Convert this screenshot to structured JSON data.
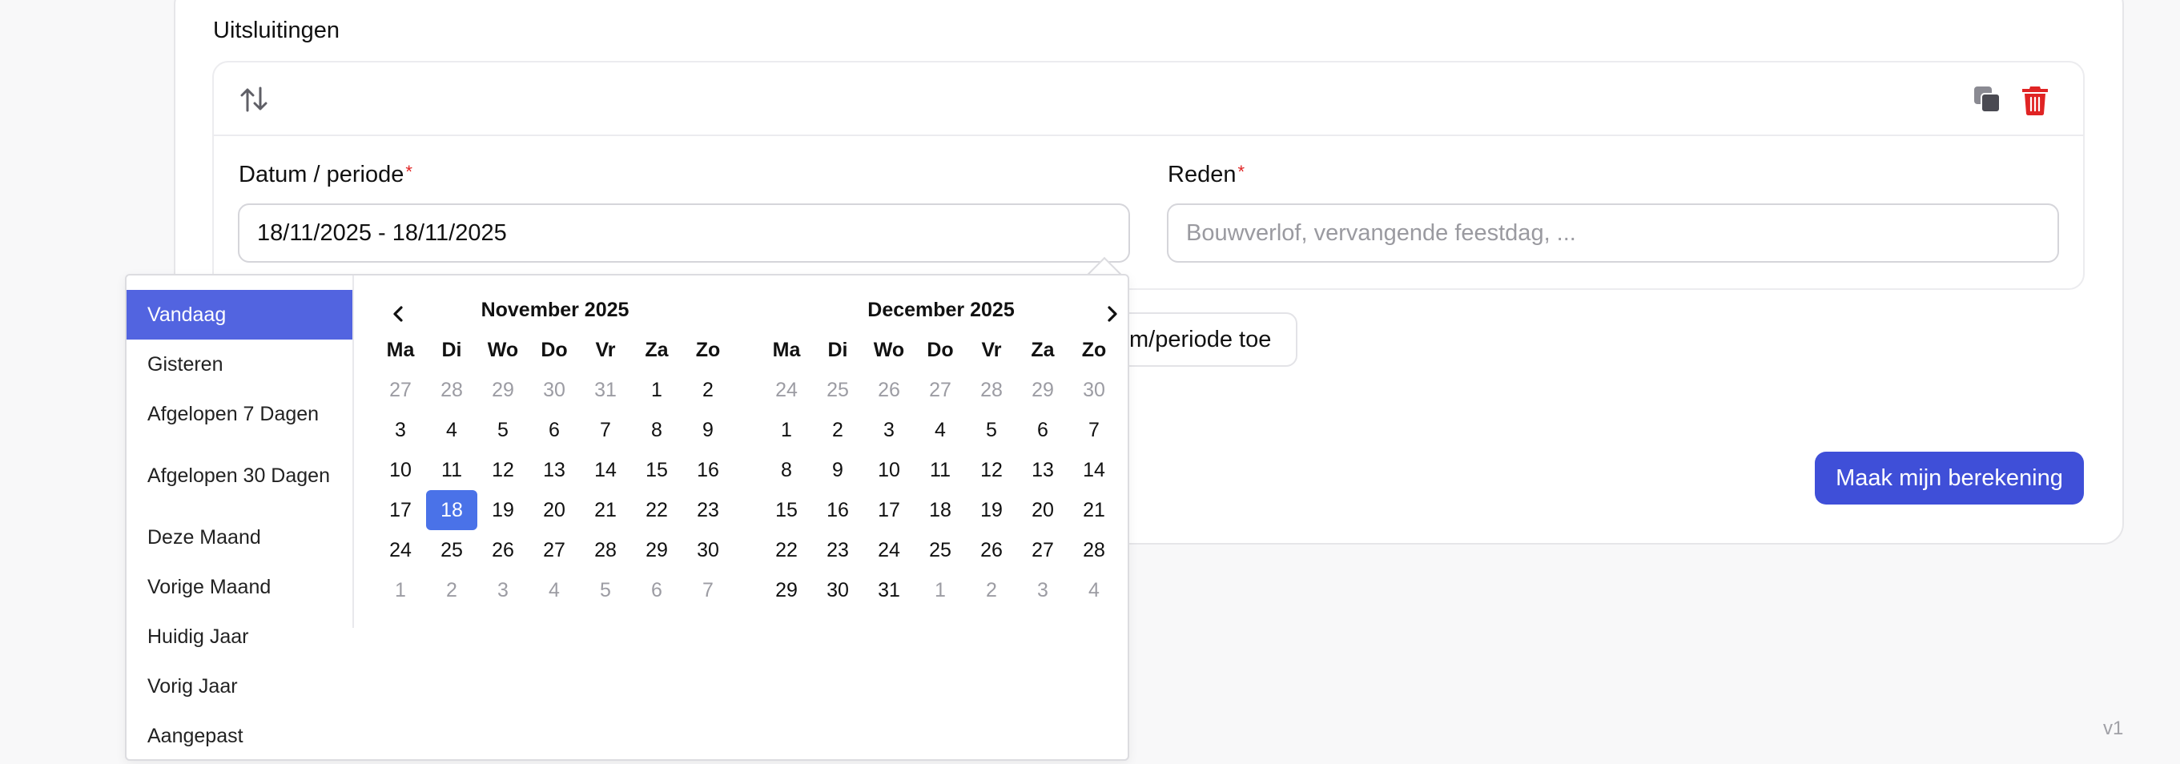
{
  "section": {
    "title": "Uitsluitingen"
  },
  "form": {
    "date_label": "Datum / periode",
    "date_required": "*",
    "date_value": "18/11/2025 - 18/11/2025",
    "reason_label": "Reden",
    "reason_required": "*",
    "reason_placeholder": "Bouwverlof, vervangende feestdag, ..."
  },
  "add_button": {
    "label": "m/periode toe"
  },
  "calc_button": {
    "label": "Maak mijn berekening"
  },
  "version": "v1",
  "icons": {
    "sort": "sort-arrows-icon",
    "copy": "copy-icon",
    "trash": "trash-icon",
    "prev": "chevron-left-icon",
    "next": "chevron-right-icon"
  },
  "colors": {
    "accent": "#3f4fd8",
    "active_range": "#5264e0",
    "selected_day": "#4a72e8",
    "danger": "#e02424"
  },
  "picker": {
    "ranges": [
      {
        "label": "Vandaag",
        "active": true
      },
      {
        "label": "Gisteren"
      },
      {
        "label": "Afgelopen 7 Dagen"
      },
      {
        "label": "Afgelopen 30 Dagen"
      },
      {
        "label": "Deze Maand"
      },
      {
        "label": "Vorige Maand"
      },
      {
        "label": "Huidig Jaar"
      },
      {
        "label": "Vorig Jaar"
      },
      {
        "label": "Aangepast"
      }
    ],
    "weekdays": [
      "Ma",
      "Di",
      "Wo",
      "Do",
      "Vr",
      "Za",
      "Zo"
    ],
    "months": [
      {
        "title": "November 2025",
        "days": [
          {
            "d": "27",
            "off": true
          },
          {
            "d": "28",
            "off": true
          },
          {
            "d": "29",
            "off": true
          },
          {
            "d": "30",
            "off": true
          },
          {
            "d": "31",
            "off": true
          },
          {
            "d": "1"
          },
          {
            "d": "2"
          },
          {
            "d": "3"
          },
          {
            "d": "4"
          },
          {
            "d": "5"
          },
          {
            "d": "6"
          },
          {
            "d": "7"
          },
          {
            "d": "8"
          },
          {
            "d": "9"
          },
          {
            "d": "10"
          },
          {
            "d": "11"
          },
          {
            "d": "12"
          },
          {
            "d": "13"
          },
          {
            "d": "14"
          },
          {
            "d": "15"
          },
          {
            "d": "16"
          },
          {
            "d": "17"
          },
          {
            "d": "18",
            "sel": true
          },
          {
            "d": "19"
          },
          {
            "d": "20"
          },
          {
            "d": "21"
          },
          {
            "d": "22"
          },
          {
            "d": "23"
          },
          {
            "d": "24"
          },
          {
            "d": "25"
          },
          {
            "d": "26"
          },
          {
            "d": "27"
          },
          {
            "d": "28"
          },
          {
            "d": "29"
          },
          {
            "d": "30"
          },
          {
            "d": "1",
            "off": true
          },
          {
            "d": "2",
            "off": true
          },
          {
            "d": "3",
            "off": true
          },
          {
            "d": "4",
            "off": true
          },
          {
            "d": "5",
            "off": true
          },
          {
            "d": "6",
            "off": true
          },
          {
            "d": "7",
            "off": true
          }
        ]
      },
      {
        "title": "December 2025",
        "days": [
          {
            "d": "24",
            "off": true
          },
          {
            "d": "25",
            "off": true
          },
          {
            "d": "26",
            "off": true
          },
          {
            "d": "27",
            "off": true
          },
          {
            "d": "28",
            "off": true
          },
          {
            "d": "29",
            "off": true
          },
          {
            "d": "30",
            "off": true
          },
          {
            "d": "1"
          },
          {
            "d": "2"
          },
          {
            "d": "3"
          },
          {
            "d": "4"
          },
          {
            "d": "5"
          },
          {
            "d": "6"
          },
          {
            "d": "7"
          },
          {
            "d": "8"
          },
          {
            "d": "9"
          },
          {
            "d": "10"
          },
          {
            "d": "11"
          },
          {
            "d": "12"
          },
          {
            "d": "13"
          },
          {
            "d": "14"
          },
          {
            "d": "15"
          },
          {
            "d": "16"
          },
          {
            "d": "17"
          },
          {
            "d": "18"
          },
          {
            "d": "19"
          },
          {
            "d": "20"
          },
          {
            "d": "21"
          },
          {
            "d": "22"
          },
          {
            "d": "23"
          },
          {
            "d": "24"
          },
          {
            "d": "25"
          },
          {
            "d": "26"
          },
          {
            "d": "27"
          },
          {
            "d": "28"
          },
          {
            "d": "29"
          },
          {
            "d": "30"
          },
          {
            "d": "31"
          },
          {
            "d": "1",
            "off": true
          },
          {
            "d": "2",
            "off": true
          },
          {
            "d": "3",
            "off": true
          },
          {
            "d": "4",
            "off": true
          }
        ]
      }
    ]
  }
}
